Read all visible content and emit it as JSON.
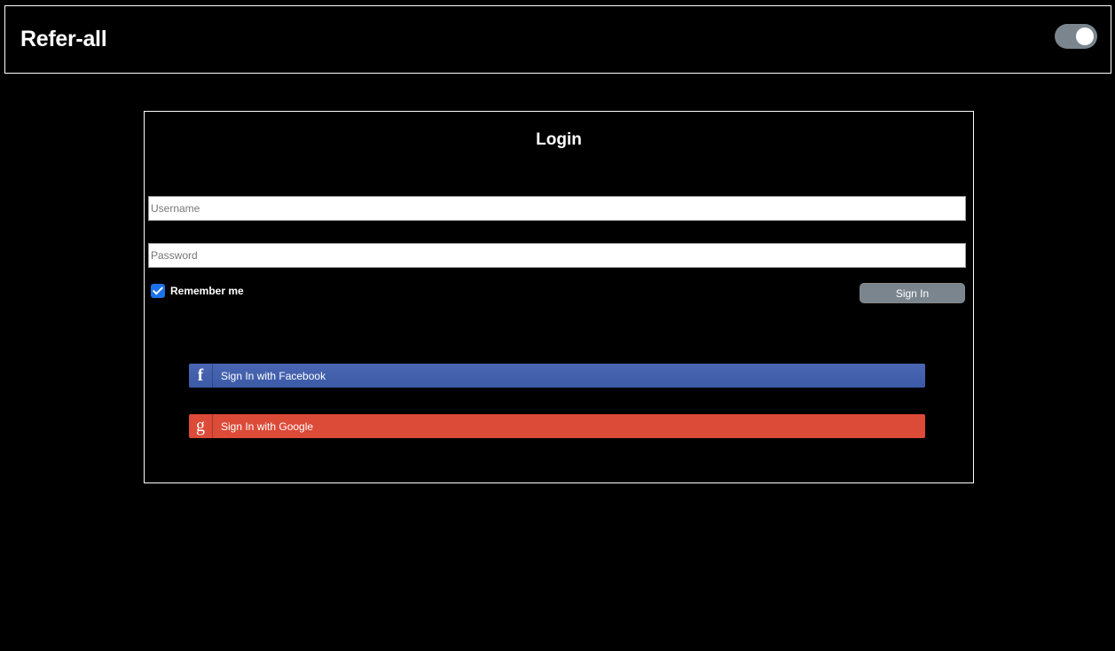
{
  "header": {
    "title": "Refer-all"
  },
  "login": {
    "title": "Login",
    "username": {
      "placeholder": "Username",
      "value": ""
    },
    "password": {
      "placeholder": "Password",
      "value": ""
    },
    "remember_label": "Remember me",
    "remember_checked": true,
    "signin_label": "Sign In",
    "facebook_label": "Sign In with Facebook",
    "facebook_icon": "f",
    "google_label": "Sign In with Google",
    "google_icon": "g"
  },
  "colors": {
    "background": "#000000",
    "toggle": "#7a858e",
    "checkbox": "#1a73e8",
    "facebook": "#3b5aa5",
    "google": "#dc4a38"
  }
}
